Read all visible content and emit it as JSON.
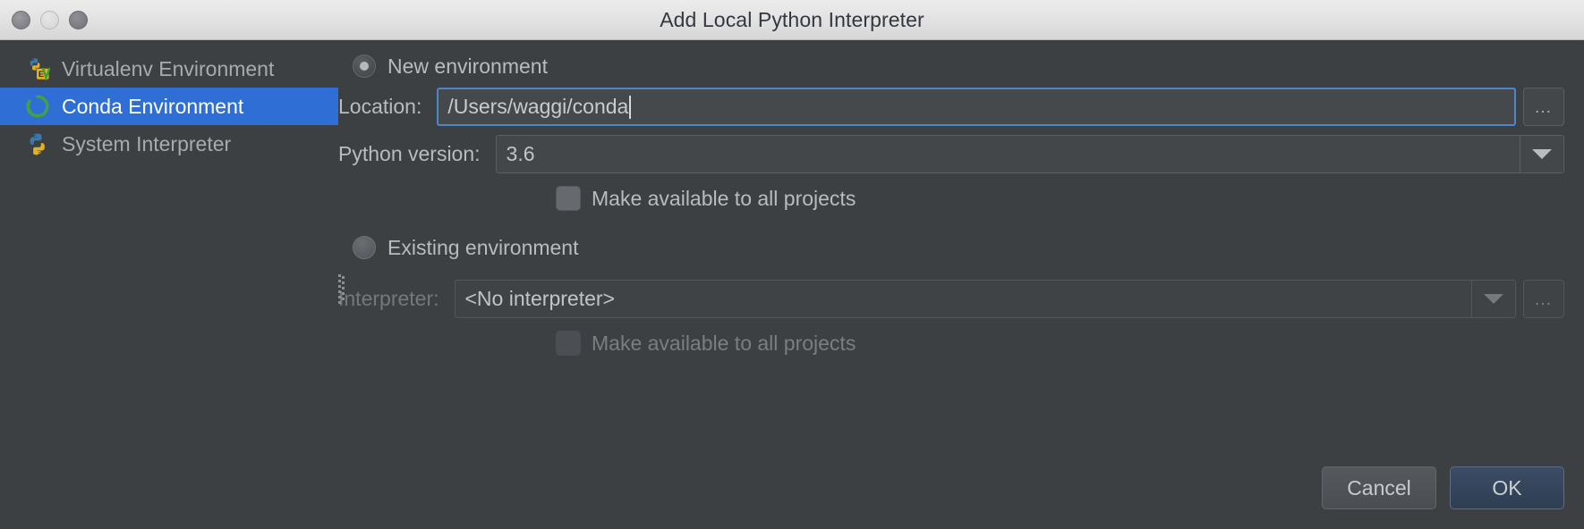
{
  "window": {
    "title": "Add Local Python Interpreter",
    "traffic_lights": [
      "close-button",
      "minimize-button",
      "maximize-button"
    ]
  },
  "sidebar": {
    "items": [
      {
        "label": "Virtualenv Environment",
        "icon": "python-virtualenv-icon",
        "selected": false
      },
      {
        "label": "Conda Environment",
        "icon": "conda-icon",
        "selected": true
      },
      {
        "label": "System Interpreter",
        "icon": "python-icon",
        "selected": false
      }
    ]
  },
  "main": {
    "new_environment": {
      "radio_label": "New environment",
      "selected": true,
      "location": {
        "label": "Location:",
        "value": "/Users/waggi/conda",
        "browse_label": "…"
      },
      "python_version": {
        "label": "Python version:",
        "value": "3.6",
        "options": [
          "3.6"
        ]
      },
      "make_available": {
        "label": "Make available to all projects",
        "checked": false
      }
    },
    "existing_environment": {
      "radio_label": "Existing environment",
      "selected": false,
      "interpreter": {
        "label": "Interpreter:",
        "value": "<No interpreter>",
        "browse_label": "…",
        "disabled": true
      },
      "make_available": {
        "label": "Make available to all projects",
        "checked": false,
        "disabled": true
      }
    }
  },
  "footer": {
    "cancel_label": "Cancel",
    "ok_label": "OK"
  },
  "colors": {
    "background": "#3c4043",
    "selection": "#2f6ed5",
    "focus_border": "#4b87c8",
    "ok_button": "#35465d",
    "text": "#b9bbbd",
    "text_disabled": "#74787c",
    "titlebar": "#e4e4e4"
  }
}
